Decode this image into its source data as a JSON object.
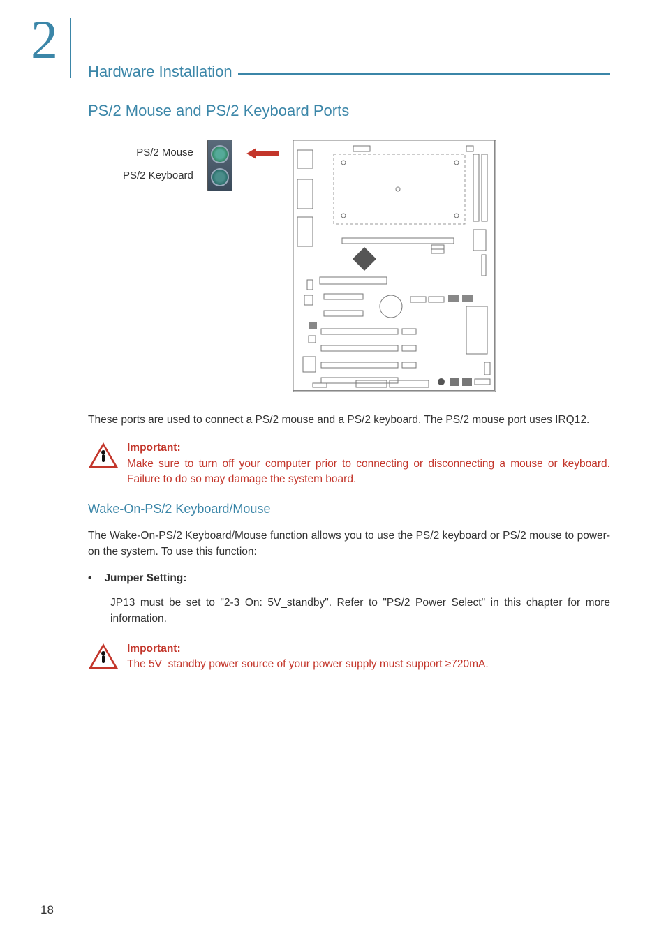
{
  "chapter_number": "2",
  "section_header": "Hardware Installation",
  "title": "PS/2 Mouse and PS/2 Keyboard Ports",
  "port_labels": {
    "mouse": "PS/2 Mouse",
    "keyboard": "PS/2 Keyboard"
  },
  "body_p1": "These ports are used to connect a PS/2 mouse and a PS/2 keyboard. The PS/2 mouse port uses IRQ12.",
  "important1": {
    "label": "Important:",
    "body": "Make sure to turn off your computer prior to connecting or disconnecting a mouse or keyboard. Failure to do so may damage the system board."
  },
  "subheading": "Wake-On-PS/2 Keyboard/Mouse",
  "body_p2": "The Wake-On-PS/2 Keyboard/Mouse function allows you to use the PS/2 keyboard or PS/2 mouse to power-on the system. To use this function:",
  "bullet": {
    "label": "Jumper Setting:",
    "body": "JP13 must be set to \"2-3 On: 5V_standby\". Refer to \"PS/2 Power Select\" in this chapter for more information."
  },
  "important2": {
    "label": "Important:",
    "body": "The 5V_standby power source of your power supply must support ≥720mA."
  },
  "page_number": "18"
}
